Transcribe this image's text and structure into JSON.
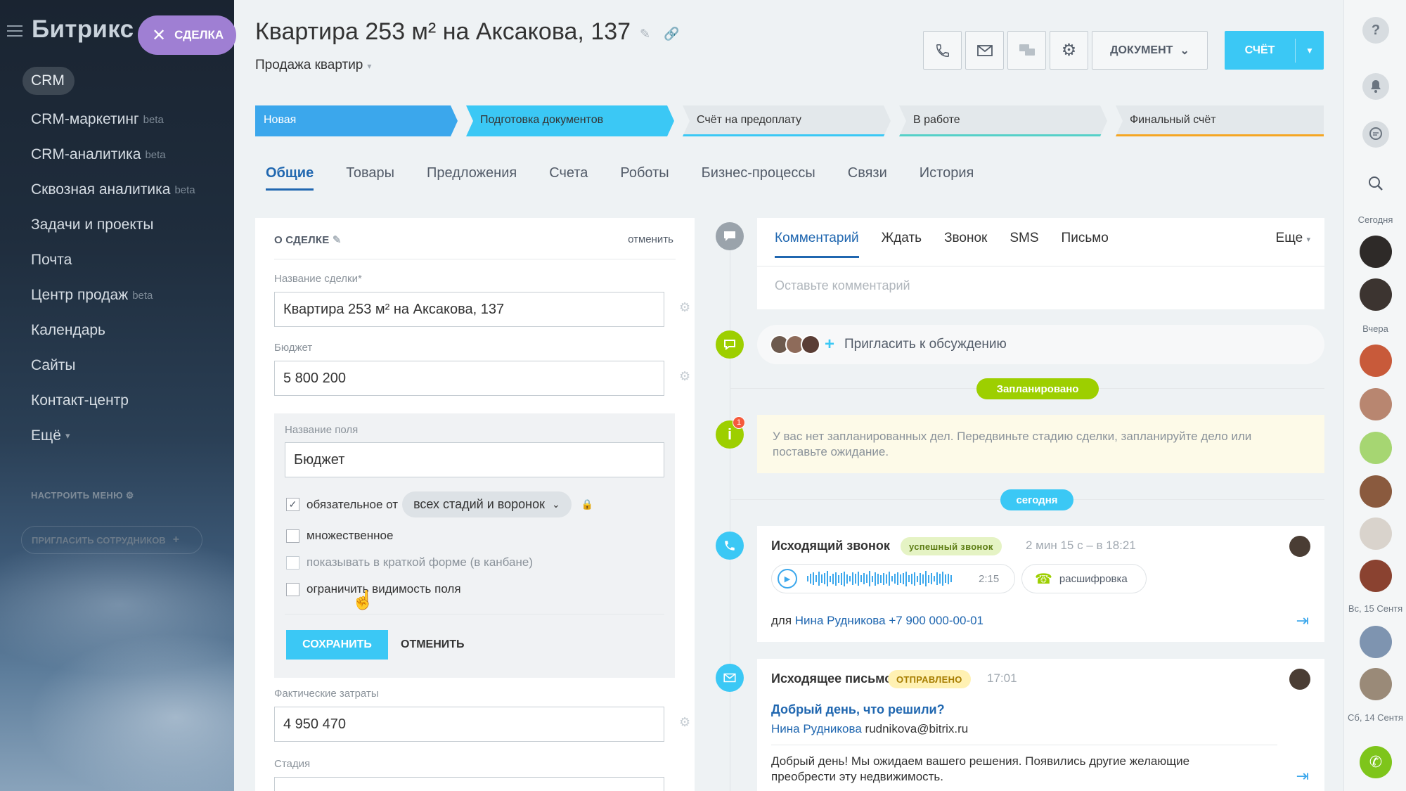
{
  "sidebar": {
    "logo": "Битрикс 2",
    "deal_pill": "СДЕЛКА",
    "items": [
      {
        "label": "CRM"
      },
      {
        "label": "CRM-маркетинг",
        "badge": "beta"
      },
      {
        "label": "CRM-аналитика",
        "badge": "beta"
      },
      {
        "label": "Сквозная аналитика",
        "badge": "beta"
      },
      {
        "label": "Задачи и проекты"
      },
      {
        "label": "Почта"
      },
      {
        "label": "Центр продаж",
        "badge": "beta"
      },
      {
        "label": "Календарь"
      },
      {
        "label": "Сайты"
      },
      {
        "label": "Контакт-центр"
      },
      {
        "label": "Ещё"
      }
    ],
    "setup_menu": "НАСТРОИТЬ МЕНЮ",
    "invite": "ПРИГЛАСИТЬ СОТРУДНИКОВ"
  },
  "header": {
    "title": "Квартира 253 м² на Аксакова, 137",
    "subtitle": "Продажа квартир",
    "document_btn": "ДОКУМЕНТ",
    "bill_btn": "СЧЁТ"
  },
  "stages": [
    "Новая",
    "Подготовка документов",
    "Счёт на предоплату",
    "В работе",
    "Финальный счёт"
  ],
  "tabs": [
    "Общие",
    "Товары",
    "Предложения",
    "Счета",
    "Роботы",
    "Бизнес-процессы",
    "Связи",
    "История"
  ],
  "card": {
    "title": "О СДЕЛКЕ",
    "cancel": "отменить",
    "deal_name_label": "Название сделки*",
    "deal_name_value": "Квартира 253 м² на Аксакова, 137",
    "budget_label": "Бюджет",
    "budget_value": "5 800 200",
    "field_name_label": "Название поля",
    "field_name_value": "Бюджет",
    "required_label": "обязательное от",
    "required_select": "всех стадий и воронок",
    "multiple_label": "множественное",
    "kanban_label": "показывать в краткой форме (в канбане)",
    "visibility_label": "ограничить видимость поля",
    "save": "СОХРАНИТЬ",
    "cancel_btn": "ОТМЕНИТЬ",
    "actual_cost_label": "Фактические затраты",
    "actual_cost_value": "4 950 470",
    "stage_label": "Стадия"
  },
  "comment": {
    "tabs": [
      "Комментарий",
      "Ждать",
      "Звонок",
      "SMS",
      "Письмо"
    ],
    "more": "Еще",
    "placeholder": "Оставьте комментарий"
  },
  "invite_discussion": "Пригласить к обсуждению",
  "planned_badge": "Запланировано",
  "notice": {
    "count": "1",
    "text": "У вас нет запланированных дел. Передвиньте стадию сделки, запланируйте дело или поставьте ожидание."
  },
  "today_badge": "сегодня",
  "call": {
    "title": "Исходящий звонок",
    "tag": "успешный звонок",
    "meta": "2 мин 15 с – в 18:21",
    "duration": "2:15",
    "transcript": "расшифровка",
    "for_label": "для",
    "contact": "Нина Рудникова",
    "phone": "+7 900 000-00-01"
  },
  "email": {
    "title": "Исходящее письмо",
    "tag": "ОТПРАВЛЕНО",
    "time": "17:01",
    "subject": "Добрый день, что решили?",
    "contact": "Нина Рудникова",
    "address": "rudnikova@bitrix.ru",
    "body_line1": "Добрый день! Мы ожидаем вашего решения. Появились другие желающие",
    "body_line2": "преобрести эту недвижимость."
  },
  "rail": {
    "today": "Сегодня",
    "yesterday": "Вчера",
    "sun": "Вс, 15 Сентя",
    "sat": "Сб, 14 Сентя"
  },
  "colors": {
    "accent": "#3bc8f5",
    "stage_new": "#3ba7ec",
    "link": "#2067b0",
    "green": "#9dcf00",
    "purple": "#9f7fd3"
  }
}
